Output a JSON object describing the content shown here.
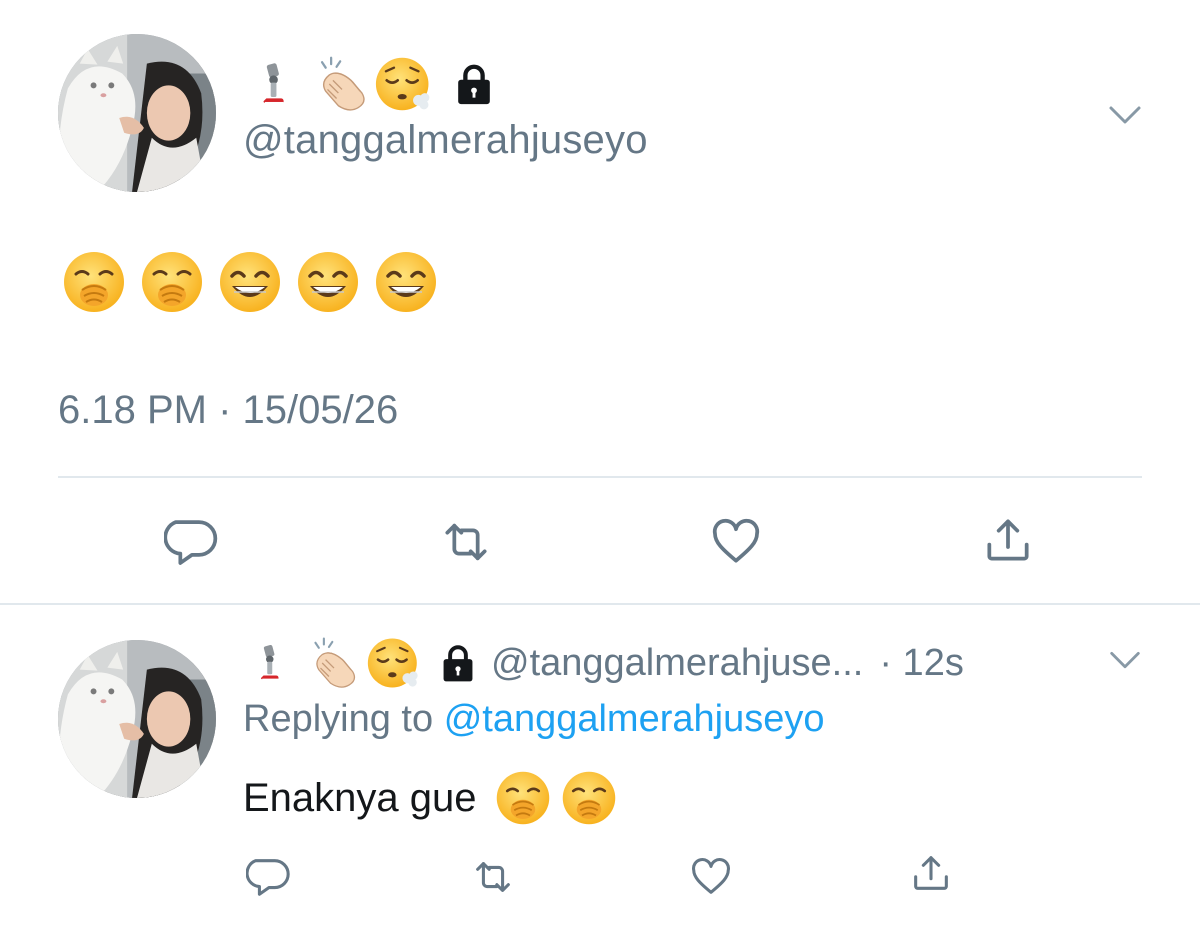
{
  "tweet": {
    "name_emojis": [
      "mechanical-leg",
      "clapping-hands",
      "face-exhaling",
      "lock"
    ],
    "handle": "@tanggalmerahjuseyo",
    "body_emojis": [
      "face-with-hand-over-mouth",
      "face-with-hand-over-mouth",
      "beaming-face",
      "beaming-face",
      "beaming-face"
    ],
    "timestamp": "6.18 PM · 15/05/26"
  },
  "actions": [
    "reply",
    "retweet",
    "like",
    "share"
  ],
  "reply": {
    "name_emojis": [
      "mechanical-leg",
      "clapping-hands",
      "face-exhaling",
      "lock"
    ],
    "handle": "@tanggalmerahjuse...",
    "time": "· 12s",
    "replying_prefix": "Replying to",
    "replying_handle": "@tanggalmerahjuseyo",
    "text": "Enaknya gue",
    "text_emojis": [
      "face-with-hand-over-mouth",
      "face-with-hand-over-mouth"
    ]
  },
  "colors": {
    "secondary_text": "#657786",
    "link": "#1da1f2",
    "divider": "#e1e8ed"
  }
}
